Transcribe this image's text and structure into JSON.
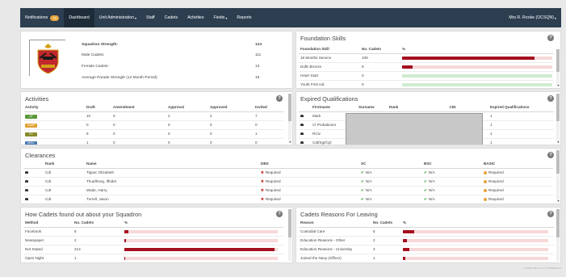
{
  "nav": {
    "notifications": "Notifications",
    "notifications_count": "33",
    "dashboard": "Dashboard",
    "unit_admin": "Unit Administration",
    "staff": "Staff",
    "cadets": "Cadets",
    "activities": "Activities",
    "fields": "Fields",
    "reports": "Reports",
    "user": "Mrs R. Rooke (OCSQN)"
  },
  "squadron": {
    "rows": [
      {
        "label": "Squadron Strength:",
        "value": "124",
        "bold": true
      },
      {
        "label": "Male Cadets:",
        "value": "111"
      },
      {
        "label": "Female Cadets:",
        "value": "13"
      },
      {
        "label": "Average Parade Strength (12 Month Period)",
        "value": "19"
      }
    ]
  },
  "foundation": {
    "title": "Foundation Skills",
    "headers": [
      "Foundation Skill",
      "No. Cadets",
      "%"
    ],
    "rows": [
      {
        "skill": "18 Months Service",
        "count": "109",
        "pct": 0.88,
        "color": "red"
      },
      {
        "skill": "DofE Bronze",
        "count": "9",
        "pct": 0.07,
        "color": "red"
      },
      {
        "skill": "Heart Start",
        "count": "0",
        "pct": 0,
        "color": "green"
      },
      {
        "skill": "Youth First Aid",
        "count": "0",
        "pct": 0,
        "color": "green"
      }
    ]
  },
  "activities": {
    "title": "Activities",
    "headers": [
      "Activity",
      "Draft",
      "Amendment",
      "Approval",
      "Approved",
      "Invited"
    ],
    "rows": [
      {
        "tag": "AT",
        "tag_color": "#5a9a3a",
        "draft": "10",
        "amendment": "0",
        "approval": "2",
        "approved": "2",
        "invited": "7"
      },
      {
        "tag": "CAMP",
        "tag_color": "#e0a030",
        "draft": "0",
        "amendment": "0",
        "approval": "0",
        "approved": "0",
        "invited": "0"
      },
      {
        "tag": "FC",
        "tag_color": "#8a8a2a",
        "draft": "8",
        "amendment": "0",
        "approval": "0",
        "approved": "0",
        "invited": "1"
      },
      {
        "tag": "MISC",
        "tag_color": "#4a7ab0",
        "draft": "1",
        "amendment": "0",
        "approval": "0",
        "approved": "0",
        "invited": "0"
      }
    ]
  },
  "expired": {
    "title": "Expired Qualifications",
    "headers": [
      "Firstname",
      "Surname",
      "Rank",
      "CIN",
      "Expired Qualifications"
    ],
    "rows": [
      {
        "first": "Mark",
        "count": "1"
      },
      {
        "first": "Cl Probationer",
        "count": "1"
      },
      {
        "first": "RCiv",
        "count": "1"
      },
      {
        "first": "Cdt/Sgt/Cpl",
        "count": "1"
      }
    ]
  },
  "clearances": {
    "title": "Clearances",
    "headers": [
      "Rank",
      "Name",
      "DBS",
      "SC",
      "BSC",
      "BASIC"
    ],
    "rows": [
      {
        "rank": "Cdt",
        "name": "Tipper, Elizabeth",
        "dbs": "Required",
        "sc": "N/A",
        "bsc": "N/A",
        "basic": "Required"
      },
      {
        "rank": "Cdt",
        "name": "Thuaflrong, Iffridel",
        "dbs": "Required",
        "sc": "N/A",
        "bsc": "N/A",
        "basic": "Required"
      },
      {
        "rank": "Cdt",
        "name": "Wade, Harry",
        "dbs": "Required",
        "sc": "N/A",
        "bsc": "N/A",
        "basic": "Required"
      },
      {
        "rank": "Cdt",
        "name": "Turrell, Jason",
        "dbs": "Required",
        "sc": "N/A",
        "bsc": "N/A",
        "basic": "Required"
      }
    ]
  },
  "howfound": {
    "title": "How Cadets found out about your Squadron",
    "headers": [
      "Method",
      "No. Cadets",
      "%"
    ],
    "rows": [
      {
        "method": "Facebook",
        "count": "6",
        "pct": 0.028
      },
      {
        "method": "Newspaper",
        "count": "2",
        "pct": 0.009
      },
      {
        "method": "Not Stated",
        "count": "213",
        "pct": 0.98
      },
      {
        "method": "Open Night",
        "count": "1",
        "pct": 0.005
      }
    ]
  },
  "leaving": {
    "title": "Cadets Reasons For Leaving",
    "headers": [
      "Reason",
      "No. Cadets",
      "%"
    ],
    "rows": [
      {
        "reason": "Custodial Care",
        "count": "5",
        "pct": 0.08
      },
      {
        "reason": "Education Reasons - Other",
        "count": "2",
        "pct": 0.03
      },
      {
        "reason": "Education Reasons - University",
        "count": "3",
        "pct": 0.045
      },
      {
        "reason": "Joined the Navy (Officer)",
        "count": "1",
        "pct": 0.015
      }
    ]
  },
  "help_label": "?",
  "footer": "eCADET CMS v2.1.0 © 2018 BAeOCS"
}
